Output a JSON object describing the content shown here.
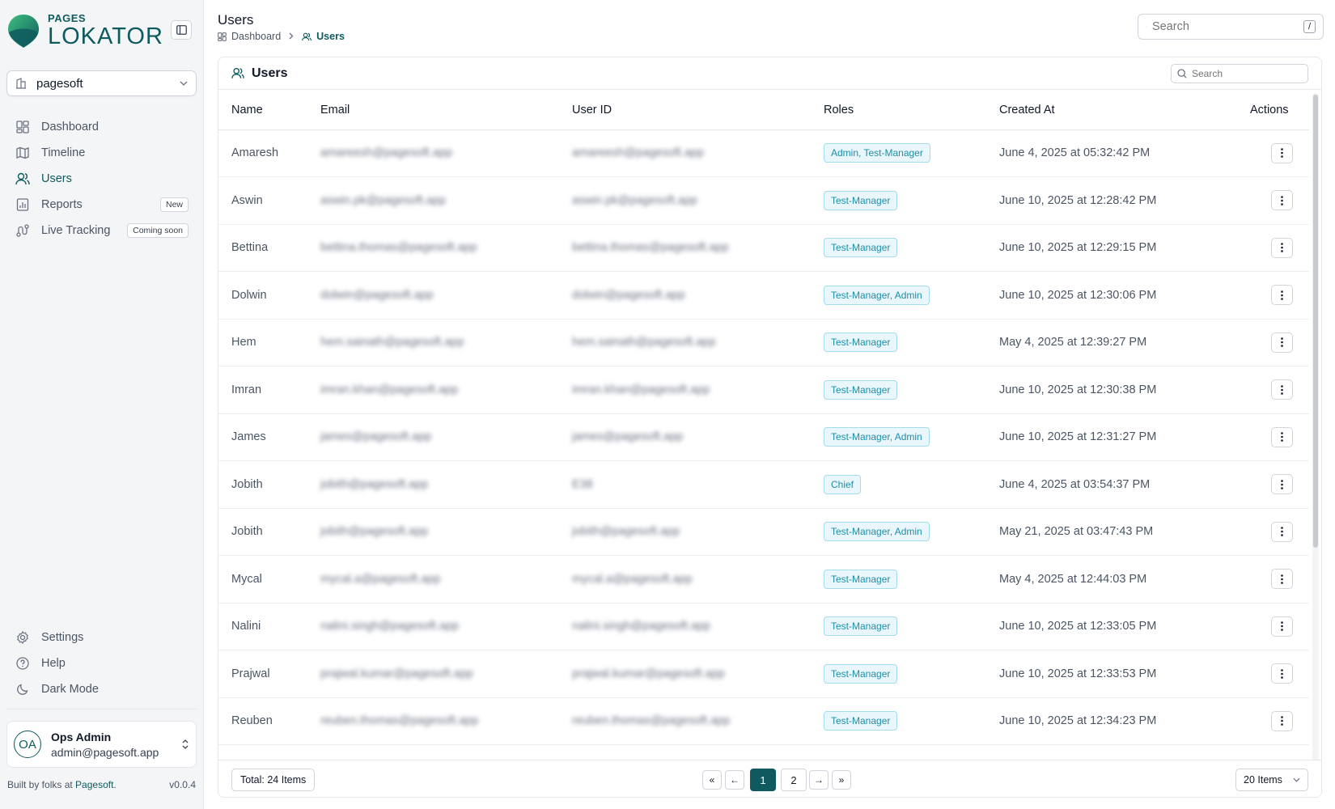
{
  "brand": {
    "small": "PAGES",
    "big": "LOKATOR"
  },
  "org": {
    "name": "pagesoft"
  },
  "nav": [
    {
      "label": "Dashboard",
      "badge": ""
    },
    {
      "label": "Timeline",
      "badge": ""
    },
    {
      "label": "Users",
      "badge": ""
    },
    {
      "label": "Reports",
      "badge": "New"
    },
    {
      "label": "Live Tracking",
      "badge": "Coming soon"
    }
  ],
  "bottom_nav": [
    {
      "label": "Settings"
    },
    {
      "label": "Help"
    },
    {
      "label": "Dark Mode"
    }
  ],
  "user": {
    "initials": "OA",
    "name": "Ops Admin",
    "email": "admin@pagesoft.app"
  },
  "footer": {
    "built_prefix": "Built by folks at ",
    "company": "Pagesoft",
    "built_suffix": ".",
    "version": "v0.0.4"
  },
  "header": {
    "title": "Users",
    "breadcrumb": [
      "Dashboard",
      "Users"
    ],
    "search_placeholder": "Search",
    "shortcut": "/"
  },
  "card": {
    "title": "Users",
    "search_placeholder": "Search"
  },
  "table": {
    "columns": [
      "Name",
      "Email",
      "User ID",
      "Roles",
      "Created At",
      "Actions"
    ],
    "rows": [
      {
        "name": "Amaresh",
        "email": "amareesh@pagesoft.app",
        "uid": "amareesh@pagesoft.app",
        "roles": "Admin, Test-Manager",
        "created": "June 4, 2025 at 05:32:42 PM"
      },
      {
        "name": "Aswin",
        "email": "aswin.pk@pagesoft.app",
        "uid": "aswin.pk@pagesoft.app",
        "roles": "Test-Manager",
        "created": "June 10, 2025 at 12:28:42 PM"
      },
      {
        "name": "Bettina",
        "email": "bettina.thomas@pagesoft.app",
        "uid": "bettina.thomas@pagesoft.app",
        "roles": "Test-Manager",
        "created": "June 10, 2025 at 12:29:15 PM"
      },
      {
        "name": "Dolwin",
        "email": "dolwin@pagesoft.app",
        "uid": "dolwin@pagesoft.app",
        "roles": "Test-Manager, Admin",
        "created": "June 10, 2025 at 12:30:06 PM"
      },
      {
        "name": "Hem",
        "email": "hem.sainath@pagesoft.app",
        "uid": "hem.sainath@pagesoft.app",
        "roles": "Test-Manager",
        "created": "May 4, 2025 at 12:39:27 PM"
      },
      {
        "name": "Imran",
        "email": "imran.khan@pagesoft.app",
        "uid": "imran.khan@pagesoft.app",
        "roles": "Test-Manager",
        "created": "June 10, 2025 at 12:30:38 PM"
      },
      {
        "name": "James",
        "email": "james@pagesoft.app",
        "uid": "james@pagesoft.app",
        "roles": "Test-Manager, Admin",
        "created": "June 10, 2025 at 12:31:27 PM"
      },
      {
        "name": "Jobith",
        "email": "jobith@pagesoft.app",
        "uid": "E38",
        "roles": "Chief",
        "created": "June 4, 2025 at 03:54:37 PM"
      },
      {
        "name": "Jobith",
        "email": "jobith@pagesoft.app",
        "uid": "jobith@pagesoft.app",
        "roles": "Test-Manager, Admin",
        "created": "May 21, 2025 at 03:47:43 PM"
      },
      {
        "name": "Mycal",
        "email": "mycal.a@pagesoft.app",
        "uid": "mycal.a@pagesoft.app",
        "roles": "Test-Manager",
        "created": "May 4, 2025 at 12:44:03 PM"
      },
      {
        "name": "Nalini",
        "email": "nalini.singh@pagesoft.app",
        "uid": "nalini.singh@pagesoft.app",
        "roles": "Test-Manager",
        "created": "June 10, 2025 at 12:33:05 PM"
      },
      {
        "name": "Prajwal",
        "email": "prajwal.kumar@pagesoft.app",
        "uid": "prajwal.kumar@pagesoft.app",
        "roles": "Test-Manager",
        "created": "June 10, 2025 at 12:33:53 PM"
      },
      {
        "name": "Reuben",
        "email": "reuben.thomas@pagesoft.app",
        "uid": "reuben.thomas@pagesoft.app",
        "roles": "Test-Manager",
        "created": "June 10, 2025 at 12:34:23 PM"
      }
    ]
  },
  "pagination": {
    "total": "Total: 24 Items",
    "first": "«",
    "prev": "←",
    "next": "→",
    "last": "»",
    "pages": [
      "1",
      "2"
    ],
    "current": "1",
    "per_page": "20 Items"
  },
  "colors": {
    "accent": "#0f5a5e",
    "role_text": "#1f8fa8",
    "role_bg": "#e9f6fb"
  }
}
